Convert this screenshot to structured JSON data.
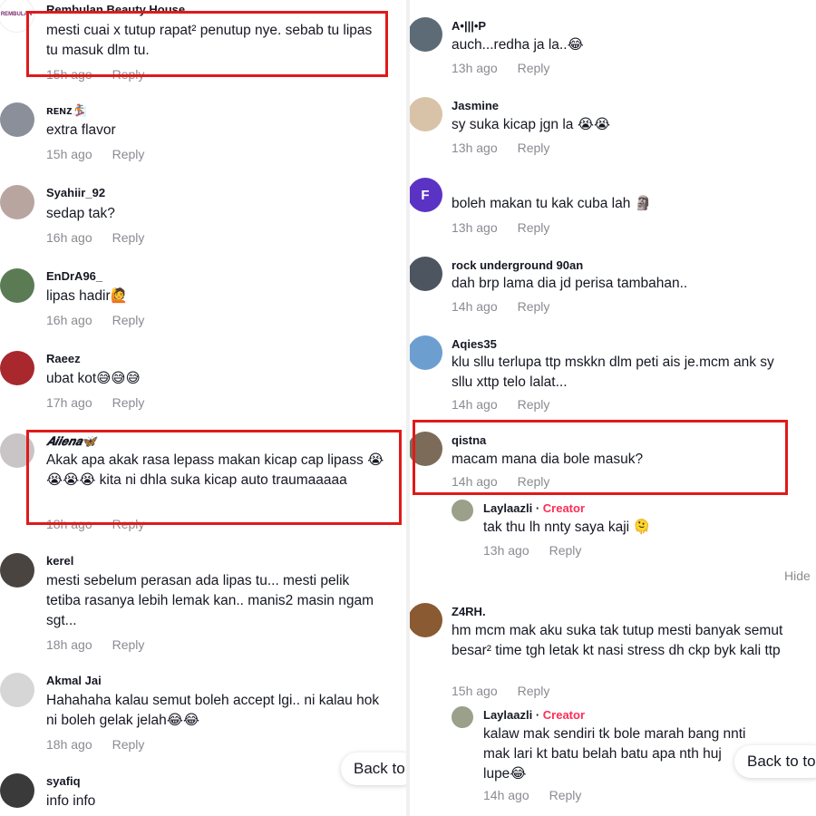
{
  "left": {
    "comments": [
      {
        "user": "Rembulan Beauty House",
        "text": "mesti cuai x tutup rapat² penutup nye. sebab tu lipas tu masuk dlm tu.",
        "time": "15h ago",
        "reply": "Reply",
        "avatar_color": "#ffffff"
      },
      {
        "user": "ʀᴇɴᴢ🏂",
        "text": "extra flavor",
        "time": "15h ago",
        "reply": "Reply",
        "avatar_color": "#8a8f99"
      },
      {
        "user": "Syahiir_92",
        "text": "sedap tak?",
        "time": "16h ago",
        "reply": "Reply",
        "avatar_color": "#b9a5a0"
      },
      {
        "user": "EnDrA96_",
        "text": "lipas hadir🙋",
        "time": "16h ago",
        "reply": "Reply",
        "avatar_color": "#5b7b55"
      },
      {
        "user": "Raeez",
        "text": "ubat kot😅😅😅",
        "time": "17h ago",
        "reply": "Reply",
        "avatar_color": "#a8282e"
      },
      {
        "user": "𝑨𝒊𝒊𝒆𝒏𝒂🦋",
        "text": "Akak apa akak rasa lepass makan kicap cap lipass 😭😭😭😭 kita ni dhla suka kicap auto traumaaaaa",
        "time": "18h ago",
        "reply": "Reply",
        "avatar_color": "#c9c4c6"
      },
      {
        "user": "kerel",
        "text": "mesti sebelum perasan ada lipas tu... mesti pelik tetiba rasanya lebih lemak kan.. manis2 masin ngam sgt...",
        "time": "18h ago",
        "reply": "Reply",
        "avatar_color": "#4a4440"
      },
      {
        "user": "Akmal Jai",
        "text": "Hahahaha kalau semut boleh accept lgi.. ni kalau hok ni boleh gelak jelah😂😂",
        "time": "18h ago",
        "reply": "Reply",
        "avatar_color": "#d6d6d6"
      },
      {
        "user": "syafiq",
        "text": "info info",
        "time": "",
        "reply": "",
        "avatar_color": "#3a3a3a"
      }
    ],
    "back_label": "Back to"
  },
  "right": {
    "comments": [
      {
        "user": "A•|||•P",
        "text": "auch...redha ja la..😂",
        "time": "13h ago",
        "reply": "Reply",
        "avatar_color": "#5d6b76"
      },
      {
        "user": "Jasmine",
        "text": "sy suka kicap jgn la 😭😭",
        "time": "13h ago",
        "reply": "Reply",
        "avatar_color": "#d9c3a8"
      },
      {
        "user": "",
        "text": "boleh makan tu kak cuba lah 🗿",
        "time": "13h ago",
        "reply": "Reply",
        "avatar_color": "#5b33c4",
        "avatar_letter": "F"
      },
      {
        "user": "rock underground 90an",
        "text": "dah brp lama dia jd perisa tambahan..",
        "time": "14h ago",
        "reply": "Reply",
        "avatar_color": "#4c5560"
      },
      {
        "user": "Aqies35",
        "text": "klu sllu terlupa ttp mskkn dlm peti ais je.mcm ank sy sllu xttp telo lalat...",
        "time": "14h ago",
        "reply": "Reply",
        "avatar_color": "#6d9ed0"
      },
      {
        "user": "qistna",
        "text": "macam mana dia bole masuk?",
        "time": "14h ago",
        "reply": "Reply",
        "avatar_color": "#7c6b58"
      },
      {
        "user": "Laylaazli",
        "creator": "Creator",
        "text": "tak thu lh nnty saya kaji 🫠",
        "time": "13h ago",
        "reply": "Reply",
        "avatar_color": "#9aa08a"
      },
      {
        "user": "Z4RH.",
        "text": "hm mcm mak aku suka tak tutup mesti banyak semut besar² time tgh letak kt nasi stress dh ckp byk kali ttp",
        "time": "15h ago",
        "reply": "Reply",
        "avatar_color": "#8a5a32"
      },
      {
        "user": "Laylaazli",
        "creator": "Creator",
        "text": "kalaw mak sendiri tk bole marah bang nnti mak lari kt batu belah batu apa nth huj lupe😂",
        "time": "14h ago",
        "reply": "Reply",
        "avatar_color": "#9aa08a"
      }
    ],
    "hide_label": "Hide",
    "back_label": "Back to to"
  },
  "avatar_letters": {
    "rembulan": "REMBULAN"
  }
}
